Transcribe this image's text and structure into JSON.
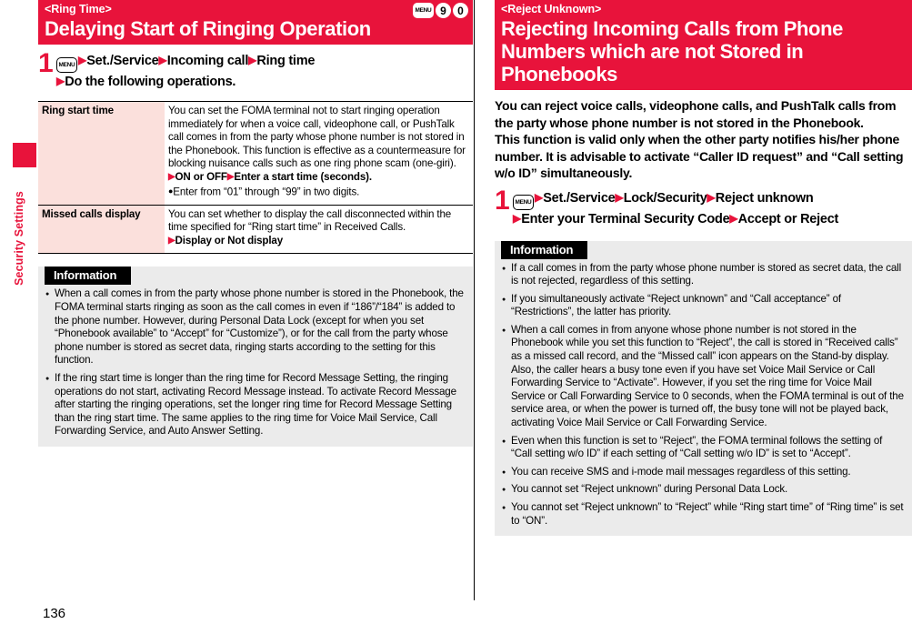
{
  "page": {
    "number": "136",
    "side_tab_label": "Security Settings",
    "accent_color": "#e8133b",
    "table_label_bg": "#fbe0dc",
    "info_bg": "#ebebeb"
  },
  "left": {
    "banner": {
      "subtitle": "<Ring Time>",
      "title": "Delaying Start of Ringing Operation",
      "keys": [
        "MENU",
        "9",
        "0"
      ]
    },
    "step": {
      "number": "1",
      "menu_key": "MENU",
      "line1": "Set./Service",
      "line1b": "Incoming call",
      "line1c": "Ring time",
      "line2": "Do the following operations."
    },
    "table": {
      "rows": [
        {
          "label": "Ring start time",
          "desc": "You can set the FOMA terminal not to start ringing operation immediately for when a voice call, videophone call, or PushTalk call comes in from the party whose phone number is not stored in the Phonebook. This function is effective as a countermeasure for blocking nuisance calls such as one ring phone scam (one-giri).",
          "action_a": "ON or OFF",
          "action_b": "Enter a start time (seconds).",
          "note": "Enter from “01” through “99” in two digits."
        },
        {
          "label": "Missed calls display",
          "desc": "You can set whether to display the call disconnected within the time specified for “Ring start time” in Received Calls.",
          "action_a": "Display or Not display",
          "action_b": "",
          "note": ""
        }
      ]
    },
    "information": {
      "header": "Information",
      "items": [
        "When a call comes in from the party whose phone number is stored in the Phonebook, the FOMA terminal starts ringing as soon as the call comes in even if “186”/“184” is added to the phone number. However, during Personal Data Lock (except for when you set “Phonebook available” to “Accept” for “Customize”), or for the call from the party whose phone number is stored as secret data, ringing starts according to the setting for this function.",
        "If the ring start time is longer than the ring time for Record Message Setting, the ringing operations do not start, activating Record Message instead. To activate Record Message after starting the ringing operations, set the longer ring time for Record Message Setting than the ring start time. The same applies to the ring time for Voice Mail Service, Call Forwarding Service, and Auto Answer Setting."
      ]
    }
  },
  "right": {
    "banner": {
      "subtitle": "<Reject Unknown>",
      "title": "Rejecting Incoming Calls from Phone Numbers which are not Stored in Phonebooks"
    },
    "intro": "You can reject voice calls, videophone calls, and PushTalk calls from the party whose phone number is not stored in the Phonebook.\nThis function is valid only when the other party notifies his/her phone number. It is advisable to activate “Caller ID request” and “Call setting w/o ID” simultaneously.",
    "step": {
      "number": "1",
      "menu_key": "MENU",
      "line1": "Set./Service",
      "line1b": "Lock/Security",
      "line1c": "Reject unknown",
      "line2a": "Enter your Terminal Security Code",
      "line2b": "Accept or Reject"
    },
    "information": {
      "header": "Information",
      "items": [
        "If a call comes in from the party whose phone number is stored as secret data, the call is not rejected, regardless of this setting.",
        "If you simultaneously activate “Reject unknown” and “Call acceptance” of “Restrictions”, the latter has priority.",
        "When a call comes in from anyone whose phone number is not stored in the Phonebook while you set this function to “Reject”, the call is stored in “Received calls” as a missed call record, and the “Missed call” icon appears on the Stand-by display. Also, the caller hears a busy tone even if you have set Voice Mail Service or Call Forwarding Service to “Activate”. However, if you set the ring time for Voice Mail Service or Call Forwarding Service to 0 seconds, when the FOMA terminal is out of the service area, or when the power is turned off, the busy tone will not be played back, activating Voice Mail Service or Call Forwarding Service.",
        "Even when this function is set to “Reject”, the FOMA terminal follows the setting of “Call setting w/o ID” if each setting of “Call setting w/o ID” is set to “Accept”.",
        "You can receive SMS and i-mode mail messages regardless of this setting.",
        "You cannot set “Reject unknown” during Personal Data Lock.",
        "You cannot set “Reject unknown” to “Reject” while “Ring start time” of “Ring time” is set to “ON”."
      ]
    }
  }
}
